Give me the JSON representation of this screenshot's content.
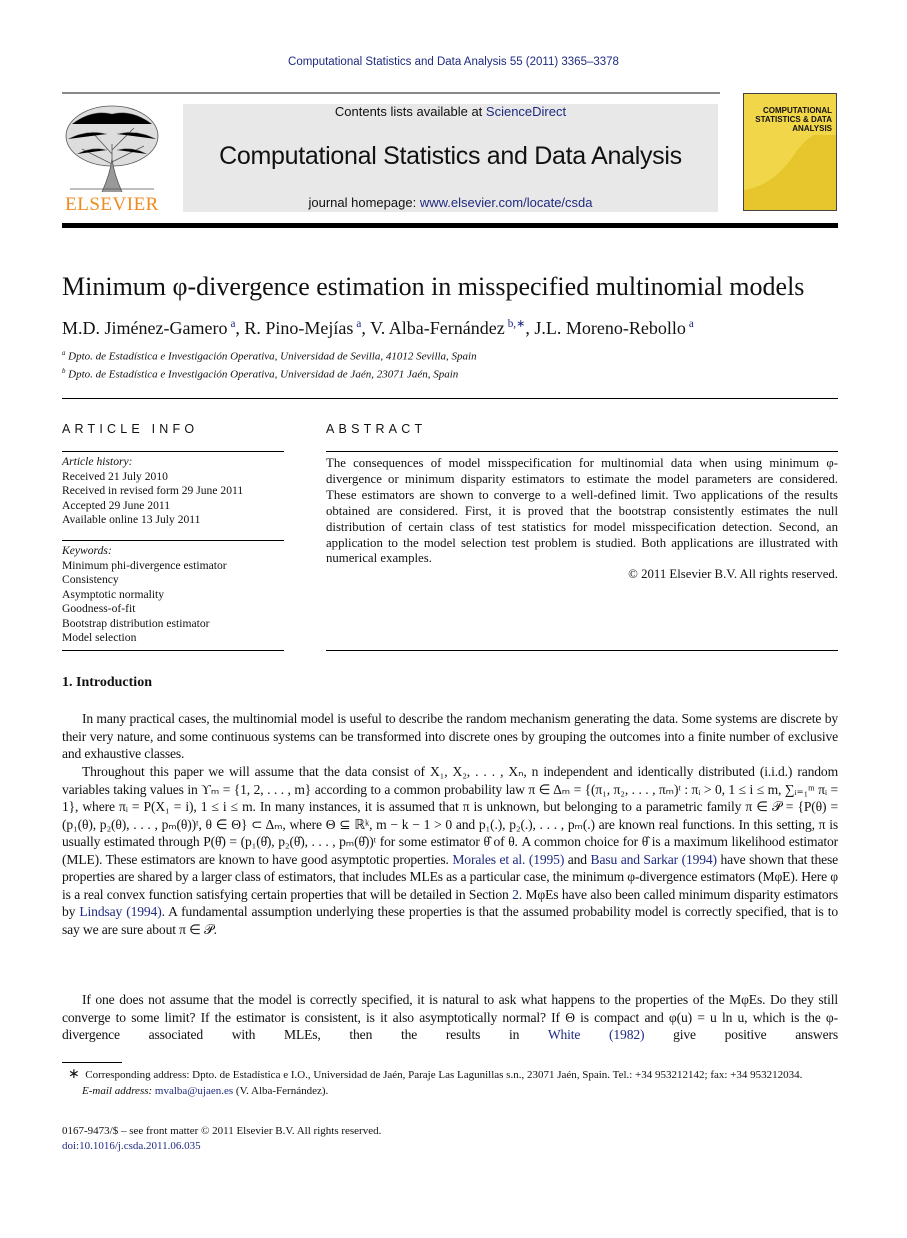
{
  "header": {
    "journal_ref": "Computational Statistics and Data Analysis 55 (2011) 3365–3378",
    "contents_prefix": "Contents lists available at ",
    "contents_link": "ScienceDirect",
    "journal_title": "Computational Statistics and Data Analysis",
    "homepage_prefix": "journal homepage: ",
    "homepage_link": "www.elsevier.com/locate/csda",
    "publisher_logo": "ELSEVIER",
    "cover_title": "COMPUTATIONAL STATISTICS & DATA ANALYSIS",
    "colors": {
      "link": "#1f2a80",
      "elsevier": "#f08a1c",
      "cover": "#f2d64a"
    }
  },
  "article": {
    "title": "Minimum φ-divergence estimation in misspecified multinomial models",
    "authors": [
      {
        "name": "M.D. Jiménez-Gamero",
        "aff": "a",
        "sep": ", "
      },
      {
        "name": "R. Pino-Mejías",
        "aff": "a",
        "sep": ", "
      },
      {
        "name": "V. Alba-Fernández",
        "aff": "b,∗",
        "sep": ", "
      },
      {
        "name": "J.L. Moreno-Rebollo",
        "aff": "a",
        "sep": ""
      }
    ],
    "affiliations": [
      {
        "mark": "a",
        "text": "Dpto. de Estadística e Investigación Operativa, Universidad de Sevilla, 41012 Sevilla, Spain"
      },
      {
        "mark": "b",
        "text": "Dpto. de Estadística e Investigación Operativa, Universidad de Jaén, 23071 Jaén, Spain"
      }
    ]
  },
  "article_info": {
    "heading": "ARTICLE INFO",
    "history_label": "Article history:",
    "history": [
      "Received 21 July 2010",
      "Received in revised form 29 June 2011",
      "Accepted 29 June 2011",
      "Available online 13 July 2011"
    ],
    "keywords_label": "Keywords:",
    "keywords": [
      "Minimum phi-divergence estimator",
      "Consistency",
      "Asymptotic normality",
      "Goodness-of-fit",
      "Bootstrap distribution estimator",
      "Model selection"
    ]
  },
  "abstract": {
    "heading": "ABSTRACT",
    "text": "The consequences of model misspecification for multinomial data when using minimum φ-divergence or minimum disparity estimators to estimate the model parameters are considered. These estimators are shown to converge to a well-defined limit. Two applications of the results obtained are considered. First, it is proved that the bootstrap consistently estimates the null distribution of certain class of test statistics for model misspecification detection. Second, an application to the model selection test problem is studied. Both applications are illustrated with numerical examples.",
    "copyright": "© 2011 Elsevier B.V. All rights reserved."
  },
  "intro": {
    "heading": "1.  Introduction",
    "paragraphs": [
      [
        {
          "t": "In many practical cases, the multinomial model is useful to describe the random mechanism generating the data. Some systems are discrete by their very nature, and some continuous systems can be transformed into discrete ones by grouping the outcomes into a finite number of exclusive and exhaustive classes."
        }
      ],
      [
        {
          "t": "Throughout this paper we will assume that the data consist of X₁, X₂, . . . , Xₙ, n independent and identically distributed (i.i.d.) random variables taking values in ϒₘ = {1, 2, . . . , m} according to a common probability law π ∈ Δₘ = {(π₁, π₂, . . . , πₘ)ᵗ : πᵢ > 0, 1 ≤ i ≤ m, ∑ᵢ₌₁ᵐ πᵢ = 1}, where πᵢ = P(X₁ = i), 1 ≤ i ≤ m. In many instances, it is assumed that π is unknown, but belonging to a parametric family π ∈ 𝒫 = {P(θ) = (p₁(θ), p₂(θ), . . . , pₘ(θ))ᵗ, θ ∈ Θ} ⊂ Δₘ, where Θ ⊆ ℝᵏ, m − k − 1 > 0 and p₁(.), p₂(.), . . . , pₘ(.) are known real functions. In this setting, π is usually estimated through P(θ̂) = (p₁(θ̂), p₂(θ̂), . . . , pₘ(θ̂))ᵗ for some estimator θ̂ of θ. A common choice for θ̂ is a maximum likelihood estimator (MLE). These estimators are known to have good asymptotic properties. "
        },
        {
          "t": "Morales et al. (1995)",
          "link": true
        },
        {
          "t": " and "
        },
        {
          "t": "Basu and Sarkar (1994)",
          "link": true
        },
        {
          "t": " have shown that these properties are shared by a larger class of estimators, that includes MLEs as a particular case, the minimum φ-divergence estimators (MφE). Here φ is a real convex function satisfying certain properties that will be detailed in Section "
        },
        {
          "t": "2",
          "link": true
        },
        {
          "t": ". MφEs have also been called minimum disparity estimators by "
        },
        {
          "t": "Lindsay (1994)",
          "link": true
        },
        {
          "t": ". A fundamental assumption underlying these properties is that the assumed probability model is correctly specified, that is to say we are sure about π ∈ 𝒫."
        }
      ],
      [
        {
          "t": "If one does not assume that the model is correctly specified, it is natural to ask what happens to the properties of the MφEs. Do they still converge to some limit? If the estimator is consistent, is it also asymptotically normal? If Θ is compact and φ(u) = u ln u, which is the φ-divergence associated with MLEs, then the results in "
        },
        {
          "t": "White (1982)",
          "link": true
        },
        {
          "t": " give positive answers"
        }
      ]
    ]
  },
  "footnote": {
    "mark": "∗",
    "text": "Corresponding address: Dpto. de Estadística e I.O., Universidad de Jaén, Paraje Las Lagunillas s.n., 23071 Jaén, Spain. Tel.: +34 953212142; fax: +34 953212034.",
    "email_label": "E-mail address: ",
    "email": "mvalba@ujaen.es",
    "email_suffix": " (V. Alba-Fernández)."
  },
  "bottom": {
    "issn": "0167-9473/$ – see front matter © 2011 Elsevier B.V. All rights reserved.",
    "doi": "doi:10.1016/j.csda.2011.06.035"
  }
}
